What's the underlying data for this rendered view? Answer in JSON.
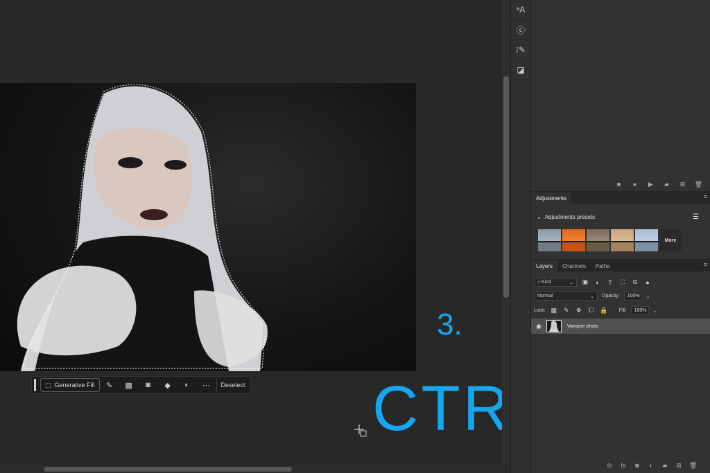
{
  "canvas": {
    "context_bar": {
      "generative_fill_label": "Generative Fill",
      "deselect_label": "Deselect",
      "icons": [
        "brush-icon",
        "selection-icon",
        "mask-icon",
        "fill-bucket-icon",
        "adjust-icon",
        "more-icon"
      ]
    },
    "overlay": {
      "step_number": "3.",
      "shortcut": "CTRL + J",
      "color": "#14a7f0"
    }
  },
  "toolstrip": {
    "icons": [
      "glyph-a-icon",
      "cr-icon",
      "brush-list-icon",
      "properties-icon"
    ]
  },
  "adjustments_panel": {
    "tabs": [
      "Adjustments"
    ],
    "presets_title": "Adjustments presets",
    "more_label": "More"
  },
  "layers_panel": {
    "tabs": [
      "Layers",
      "Channels",
      "Paths"
    ],
    "filter_kind": "Kind",
    "blend_mode": "Normal",
    "opacity_label": "Opacity:",
    "opacity_value": "100%",
    "lock_label": "Lock:",
    "fill_label": "Fill:",
    "fill_value": "100%",
    "layers": [
      {
        "name": "Vampire photo",
        "visible": true
      }
    ]
  },
  "colors": {
    "accent": "#14a7f0",
    "panel_bg": "#323232",
    "canvas_bg": "#282828",
    "selected_layer": "#505050"
  }
}
